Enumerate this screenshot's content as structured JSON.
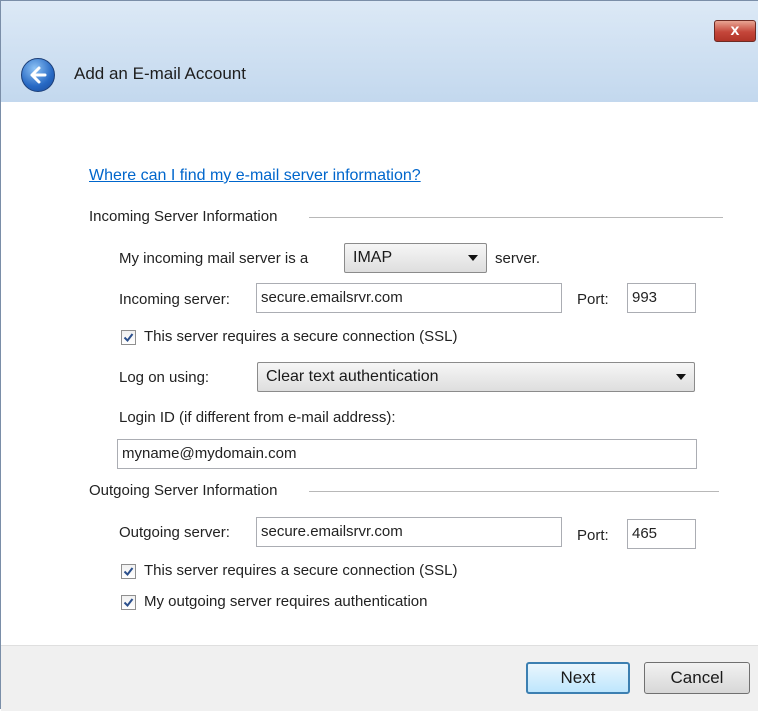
{
  "window": {
    "title": "Add an E-mail Account",
    "close_label": "x"
  },
  "help_link": "Where can I find my e-mail server information?",
  "incoming": {
    "section_title": "Incoming Server Information",
    "server_type_prefix": "My incoming mail server is a",
    "server_type": "IMAP",
    "server_type_suffix": "server.",
    "server_label": "Incoming server:",
    "server_value": "secure.emailsrvr.com",
    "port_label": "Port:",
    "port_value": "993",
    "ssl_label": "This server requires a secure connection (SSL)",
    "ssl_checked": true,
    "logon_label": "Log on using:",
    "logon_value": "Clear text authentication",
    "login_id_label": "Login ID (if different from e-mail address):",
    "login_id_value": "myname@mydomain.com"
  },
  "outgoing": {
    "section_title": "Outgoing Server Information",
    "server_label": "Outgoing server:",
    "server_value": "secure.emailsrvr.com",
    "port_label": "Port:",
    "port_value": "465",
    "ssl_label": "This server requires a secure connection (SSL)",
    "ssl_checked": true,
    "auth_label": "My outgoing server requires authentication",
    "auth_checked": true
  },
  "buttons": {
    "next": "Next",
    "cancel": "Cancel"
  }
}
